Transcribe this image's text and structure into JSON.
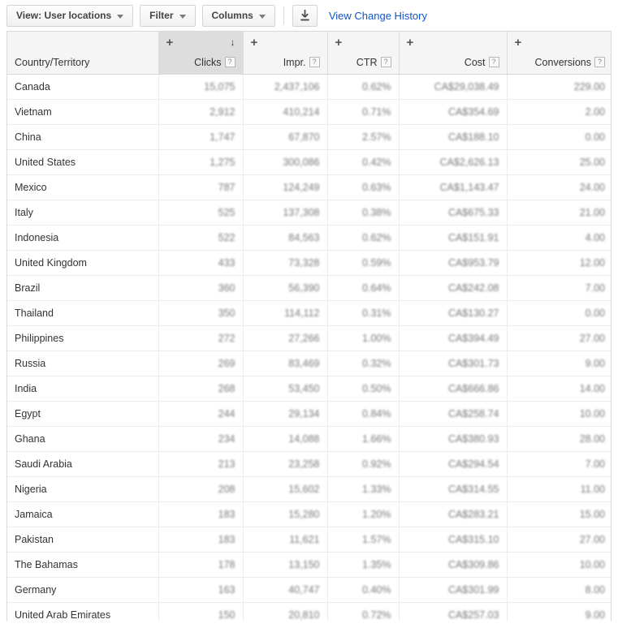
{
  "toolbar": {
    "view_button": "View: User locations",
    "filter_button": "Filter",
    "columns_button": "Columns",
    "download_icon": "download-icon",
    "change_history_link": "View Change History"
  },
  "table": {
    "columns": [
      {
        "key": "country",
        "label": "Country/Territory",
        "align": "left",
        "help": false,
        "sorted": false
      },
      {
        "key": "clicks",
        "label": "Clicks",
        "align": "right",
        "help": true,
        "sorted": true,
        "sort_dir": "desc"
      },
      {
        "key": "impr",
        "label": "Impr.",
        "align": "right",
        "help": true,
        "sorted": false
      },
      {
        "key": "ctr",
        "label": "CTR",
        "align": "right",
        "help": true,
        "sorted": false
      },
      {
        "key": "cost",
        "label": "Cost",
        "align": "right",
        "help": true,
        "sorted": false
      },
      {
        "key": "conv",
        "label": "Conversions",
        "align": "right",
        "help": true,
        "sorted": false
      }
    ],
    "help_badge_label": "?",
    "add_column_icon": "plus-icon",
    "sort_desc_icon": "arrow-down-icon",
    "rows": [
      {
        "country": "Canada",
        "clicks": "15,075",
        "impr": "2,437,106",
        "ctr": "0.62%",
        "cost": "CA$29,038.49",
        "conv": "229.00"
      },
      {
        "country": "Vietnam",
        "clicks": "2,912",
        "impr": "410,214",
        "ctr": "0.71%",
        "cost": "CA$354.69",
        "conv": "2.00"
      },
      {
        "country": "China",
        "clicks": "1,747",
        "impr": "67,870",
        "ctr": "2.57%",
        "cost": "CA$188.10",
        "conv": "0.00"
      },
      {
        "country": "United States",
        "clicks": "1,275",
        "impr": "300,086",
        "ctr": "0.42%",
        "cost": "CA$2,626.13",
        "conv": "25.00"
      },
      {
        "country": "Mexico",
        "clicks": "787",
        "impr": "124,249",
        "ctr": "0.63%",
        "cost": "CA$1,143.47",
        "conv": "24.00"
      },
      {
        "country": "Italy",
        "clicks": "525",
        "impr": "137,308",
        "ctr": "0.38%",
        "cost": "CA$675.33",
        "conv": "21.00"
      },
      {
        "country": "Indonesia",
        "clicks": "522",
        "impr": "84,563",
        "ctr": "0.62%",
        "cost": "CA$151.91",
        "conv": "4.00"
      },
      {
        "country": "United Kingdom",
        "clicks": "433",
        "impr": "73,328",
        "ctr": "0.59%",
        "cost": "CA$953.79",
        "conv": "12.00"
      },
      {
        "country": "Brazil",
        "clicks": "360",
        "impr": "56,390",
        "ctr": "0.64%",
        "cost": "CA$242.08",
        "conv": "7.00"
      },
      {
        "country": "Thailand",
        "clicks": "350",
        "impr": "114,112",
        "ctr": "0.31%",
        "cost": "CA$130.27",
        "conv": "0.00"
      },
      {
        "country": "Philippines",
        "clicks": "272",
        "impr": "27,266",
        "ctr": "1.00%",
        "cost": "CA$394.49",
        "conv": "27.00"
      },
      {
        "country": "Russia",
        "clicks": "269",
        "impr": "83,469",
        "ctr": "0.32%",
        "cost": "CA$301.73",
        "conv": "9.00"
      },
      {
        "country": "India",
        "clicks": "268",
        "impr": "53,450",
        "ctr": "0.50%",
        "cost": "CA$666.86",
        "conv": "14.00"
      },
      {
        "country": "Egypt",
        "clicks": "244",
        "impr": "29,134",
        "ctr": "0.84%",
        "cost": "CA$258.74",
        "conv": "10.00"
      },
      {
        "country": "Ghana",
        "clicks": "234",
        "impr": "14,088",
        "ctr": "1.66%",
        "cost": "CA$380.93",
        "conv": "28.00"
      },
      {
        "country": "Saudi Arabia",
        "clicks": "213",
        "impr": "23,258",
        "ctr": "0.92%",
        "cost": "CA$294.54",
        "conv": "7.00"
      },
      {
        "country": "Nigeria",
        "clicks": "208",
        "impr": "15,602",
        "ctr": "1.33%",
        "cost": "CA$314.55",
        "conv": "11.00"
      },
      {
        "country": "Jamaica",
        "clicks": "183",
        "impr": "15,280",
        "ctr": "1.20%",
        "cost": "CA$283.21",
        "conv": "15.00"
      },
      {
        "country": "Pakistan",
        "clicks": "183",
        "impr": "11,621",
        "ctr": "1.57%",
        "cost": "CA$315.10",
        "conv": "27.00"
      },
      {
        "country": "The Bahamas",
        "clicks": "178",
        "impr": "13,150",
        "ctr": "1.35%",
        "cost": "CA$309.86",
        "conv": "10.00"
      },
      {
        "country": "Germany",
        "clicks": "163",
        "impr": "40,747",
        "ctr": "0.40%",
        "cost": "CA$301.99",
        "conv": "8.00"
      },
      {
        "country": "United Arab Emirates",
        "clicks": "150",
        "impr": "20,810",
        "ctr": "0.72%",
        "cost": "CA$257.03",
        "conv": "9.00"
      }
    ]
  },
  "colors": {
    "link": "#1155cc",
    "sorted_header_bg": "#dddddd",
    "header_bg": "#f5f5f5",
    "border": "#d9d9d9"
  }
}
